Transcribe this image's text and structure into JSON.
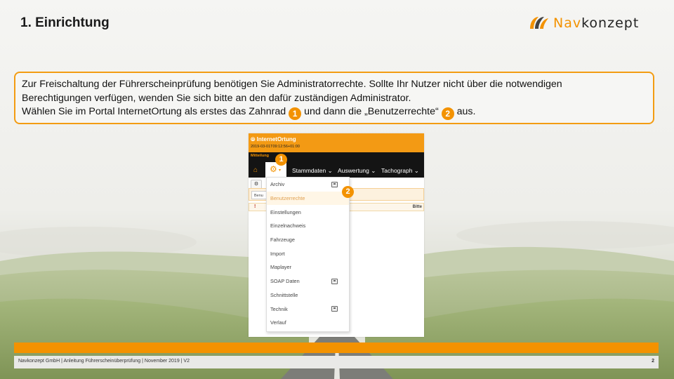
{
  "slide": {
    "title": "1. Einrichtung",
    "logo": {
      "part1": "Nav",
      "part2": "konzept"
    },
    "info": {
      "line1": "Zur Freischaltung der Führerscheinprüfung benötigen Sie Administratorrechte. Sollte Ihr Nutzer nicht über die notwendigen",
      "line2": "Berechtigungen verfügen, wenden Sie sich bitte an den dafür zuständigen Administrator.",
      "line3_a": "Wählen Sie im Portal InternetOrtung als erstes das Zahnrad",
      "line3_b": "und dann die „Benutzerrechte“",
      "line3_c": "aus.",
      "badge1": "1",
      "badge2": "2"
    },
    "accent_color": "#f39200"
  },
  "screenshot": {
    "app_logo": "InternetOrtung",
    "timestamp": "2019-03-01T09:12:56+01:00",
    "notice": "Mitteilung",
    "home_icon": "home-icon",
    "gear_icon": "gear-icon",
    "menu": [
      "Stammdaten",
      "Auswertung",
      "Tachograph"
    ],
    "menu_chevron": "⌄",
    "subtoolbar_icon": "gear-icon",
    "tab_label": "Benu",
    "warning_mark": "!",
    "hint_text": "Bitte",
    "dropdown": [
      {
        "label": "Archiv",
        "external": true
      },
      {
        "label": "Benutzerrechte",
        "highlighted": true
      },
      {
        "label": "Einstellungen"
      },
      {
        "label": "Einzelnachweis"
      },
      {
        "label": "Fahrzeuge"
      },
      {
        "label": "Import"
      },
      {
        "label": "Maplayer"
      },
      {
        "label": "SOAP Daten",
        "external": true
      },
      {
        "label": "Schnittstelle"
      },
      {
        "label": "Technik",
        "external": true
      },
      {
        "label": "Verlauf"
      }
    ],
    "badge1": "1",
    "badge2": "2"
  },
  "footer": {
    "text": "Navkonzept GmbH  |  Anleitung Führerscheinüberprüfung  |  November 2019  |  V2",
    "page": "2"
  }
}
